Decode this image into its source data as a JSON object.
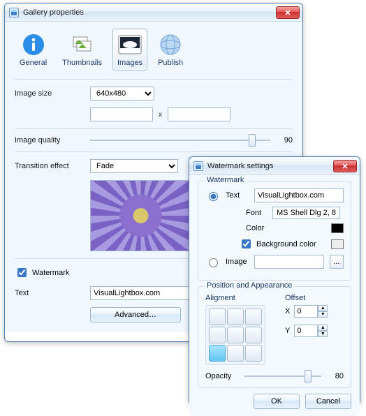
{
  "win1": {
    "title": "Gallery properties",
    "tabs": {
      "general": "General",
      "thumbnails": "Thumbnails",
      "images": "Images",
      "publish": "Publish"
    },
    "imageSizeLabel": "Image size",
    "imageSize": "640x480",
    "dimX": "x",
    "qualityLabel": "Image quality",
    "qualityValue": "90",
    "transitionLabel": "Transition effect",
    "transitionValue": "Fade",
    "watermarkLabel": "Watermark",
    "textLabel": "Text",
    "textValue": "VisualLightbox.com",
    "advanced": "Advanced…"
  },
  "win2": {
    "title": "Watermark settings",
    "group1": "Watermark",
    "radioText": "Text",
    "textValue": "VisualLightbox.com",
    "fontLabel": "Font",
    "fontValue": "MS Shell Dlg 2, 8",
    "colorLabel": "Color",
    "colorValue": "#000000",
    "bgColorLabel": "Background color",
    "bgColorValue": "#eeeeee",
    "radioImage": "Image",
    "browse": "...",
    "group2": "Position and Appearance",
    "alignLabel": "Aligment",
    "offsetLabel": "Offset",
    "xLabel": "X",
    "yLabel": "Y",
    "xValue": "0",
    "yValue": "0",
    "opacityLabel": "Opacity",
    "opacityValue": "80",
    "ok": "OK",
    "cancel": "Cancel"
  }
}
